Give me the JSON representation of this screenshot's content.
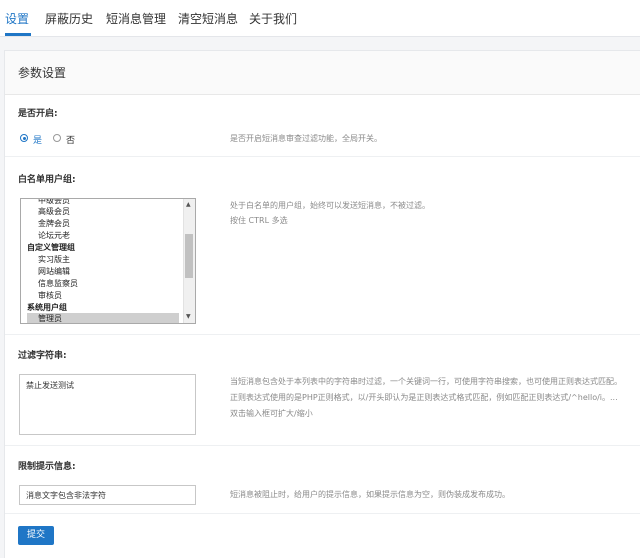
{
  "tabs": [
    {
      "label": "设置"
    },
    {
      "label": "屏蔽历史"
    },
    {
      "label": "短消息管理"
    },
    {
      "label": "清空短消息"
    },
    {
      "label": "关于我们"
    }
  ],
  "panel": {
    "title": "参数设置"
  },
  "enable": {
    "label": "是否开启:",
    "options": [
      {
        "label": "是",
        "selected": true
      },
      {
        "label": "否",
        "selected": false
      }
    ],
    "desc": "是否开启短消息审查过滤功能，全局开关。"
  },
  "whitelist": {
    "label": "白名单用户组:",
    "items": [
      {
        "text": "中级会员",
        "kind": "item"
      },
      {
        "text": "高级会员",
        "kind": "item"
      },
      {
        "text": "金牌会员",
        "kind": "item"
      },
      {
        "text": "论坛元老",
        "kind": "item"
      },
      {
        "text": "自定义管理组",
        "kind": "group"
      },
      {
        "text": "实习版主",
        "kind": "item"
      },
      {
        "text": "网站编辑",
        "kind": "item"
      },
      {
        "text": "信息监察员",
        "kind": "item"
      },
      {
        "text": "审核员",
        "kind": "item"
      },
      {
        "text": "系统用户组",
        "kind": "group"
      },
      {
        "text": "管理员",
        "kind": "selected"
      }
    ],
    "desc_line1": "处于白名单的用户组，始终可以发送短消息，不被过滤。",
    "desc_line2": "按住 CTRL 多选"
  },
  "filter": {
    "label": "过滤字符串:",
    "value": "禁止发送测试",
    "desc_line1": "当短消息包含处于本列表中的字符串时过滤，一个关键词一行，可使用字符串搜索，也可使用正则表达式匹配。",
    "desc_line2": "正则表达式使用的是PHP正则格式，以/开头即认为是正则表达式格式匹配，例如匹配正则表达式/^hello/i。...",
    "desc_line3": "双击输入框可扩大/缩小"
  },
  "notice": {
    "label": "限制提示信息:",
    "value": "消息文字包含非法字符",
    "desc": "短消息被阻止时，给用户的提示信息，如果提示信息为空，则伪装成发布成功。"
  },
  "submit": {
    "label": "提交"
  },
  "colors": {
    "accent": "#1f76c6"
  }
}
